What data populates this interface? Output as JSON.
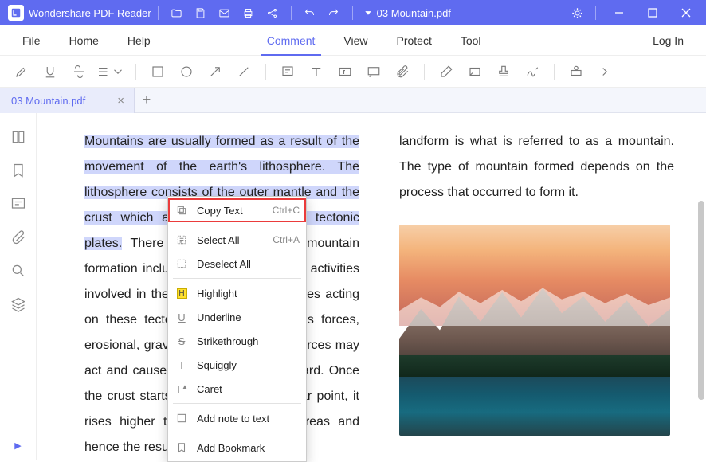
{
  "app": {
    "title": "Wondershare PDF Reader",
    "file": "03 Mountain.pdf"
  },
  "menu": {
    "file": "File",
    "home": "Home",
    "help": "Help",
    "comment": "Comment",
    "view": "View",
    "protect": "Protect",
    "tool": "Tool",
    "login": "Log In"
  },
  "tab": {
    "name": "03 Mountain.pdf"
  },
  "content": {
    "left_highlighted": "Mountains are usually formed as a result of the movement of the earth's lithosphere. The lithosphere consists of the outer mantle and the crust which are also referred to as tectonic plates.",
    "left_rest": " There are various types of mountain formation including the processes and activities involved in them. There are many forces acting on these tectonic plates. The igneous forces, erosional, gravitational, and isostatic forces may act and cause the crust to move upward. Once the crust starts to rise at that particular point, it rises higher than the surrounding areas and hence the resultant",
    "right": "landform is what is referred to as a mountain. The type of mountain formed depends on the process that occurred to form it."
  },
  "context": {
    "copy": "Copy Text",
    "copy_sc": "Ctrl+C",
    "selectall": "Select All",
    "selectall_sc": "Ctrl+A",
    "deselect": "Deselect All",
    "highlight": "Highlight",
    "underline": "Underline",
    "strike": "Strikethrough",
    "squiggly": "Squiggly",
    "caret": "Caret",
    "note": "Add note to text",
    "bookmark": "Add Bookmark"
  }
}
